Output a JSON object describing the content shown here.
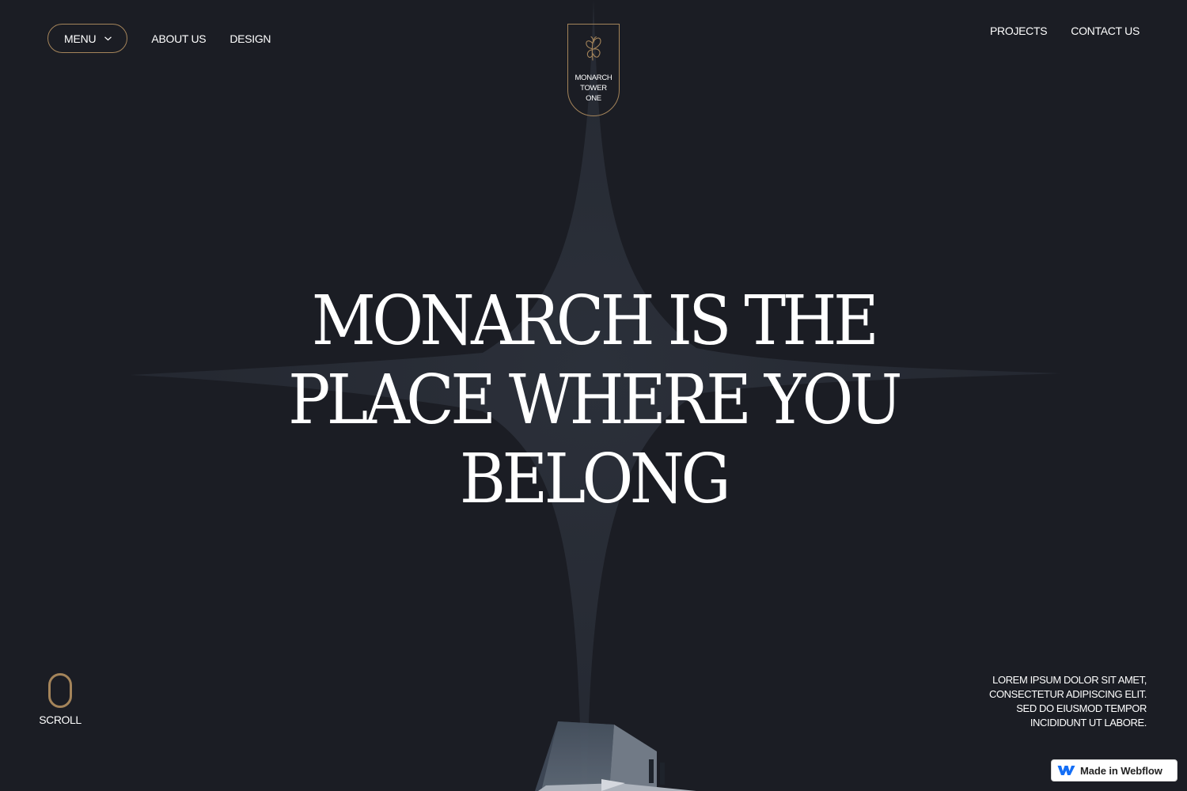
{
  "nav": {
    "menu_label": "MENU",
    "left_links": [
      "ABOUT US",
      "DESIGN"
    ],
    "right_links": [
      "PROJECTS",
      "CONTACT US"
    ]
  },
  "logo": {
    "lines": [
      "MONARCH",
      "TOWER",
      "ONE"
    ],
    "icon": "butterfly-icon"
  },
  "hero": {
    "title_lines": [
      "MONARCH IS THE",
      "PLACE WHERE YOU",
      "BELONG"
    ]
  },
  "scroll": {
    "label": "SCROLL"
  },
  "tagline": {
    "lines": [
      "LOREM IPSUM DOLOR SIT AMET,",
      "CONSECTETUR ADIPISCING ELIT.",
      "SED DO EIUSMOD TEMPOR",
      "INCIDIDUNT UT LABORE."
    ]
  },
  "badge": {
    "label": "Made in Webflow",
    "icon": "webflow-icon"
  },
  "colors": {
    "background": "#1b1d24",
    "accent_gold": "#a4845a",
    "text": "#ffffff",
    "webflow_blue": "#146ef5"
  }
}
